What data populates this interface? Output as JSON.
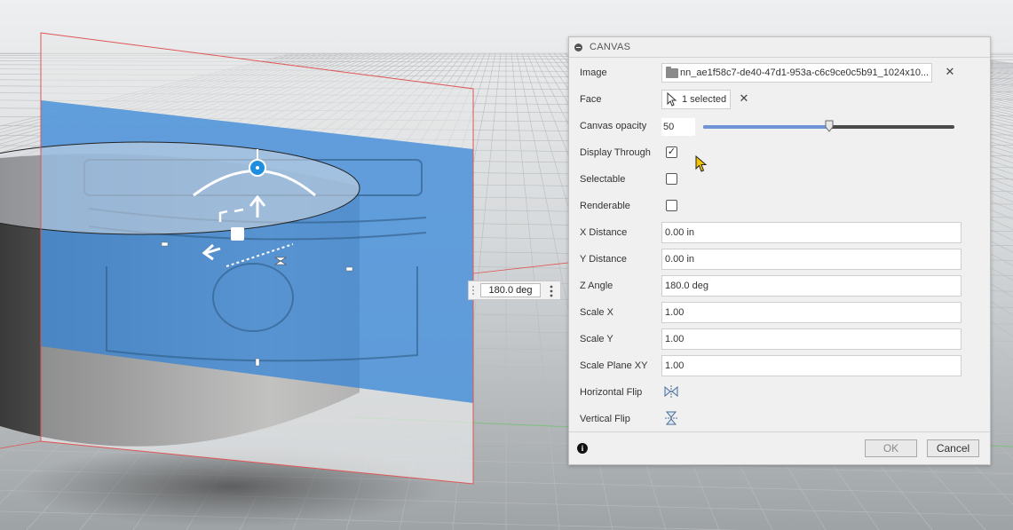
{
  "canvas_dialog": {
    "title": "CANVAS",
    "image": {
      "label": "Image",
      "value": "nn_ae1f58c7-de40-47d1-953a-c6c9ce0c5b91_1024x10..."
    },
    "face": {
      "label": "Face",
      "value": "1 selected"
    },
    "canvas_opacity": {
      "label": "Canvas opacity",
      "value": "50",
      "level_percent": 50
    },
    "display_through": {
      "label": "Display Through",
      "checked": true
    },
    "selectable": {
      "label": "Selectable",
      "checked": false
    },
    "renderable": {
      "label": "Renderable",
      "checked": false
    },
    "x_distance": {
      "label": "X Distance",
      "value": "0.00 in"
    },
    "y_distance": {
      "label": "Y Distance",
      "value": "0.00 in"
    },
    "z_angle": {
      "label": "Z Angle",
      "value": "180.0 deg"
    },
    "scale_x": {
      "label": "Scale X",
      "value": "1.00"
    },
    "scale_y": {
      "label": "Scale Y",
      "value": "1.00"
    },
    "scale_plane_xy": {
      "label": "Scale Plane XY",
      "value": "1.00"
    },
    "horizontal_flip": {
      "label": "Horizontal Flip",
      "icon": "horizontal-flip-icon"
    },
    "vertical_flip": {
      "label": "Vertical Flip",
      "icon": "vertical-flip-icon"
    },
    "ok_label": "OK",
    "cancel_label": "Cancel"
  },
  "angle_input": {
    "value": "180.0 deg"
  },
  "colors": {
    "canvas_plane_blue": "#4a90d9",
    "slider_fill": "#6f95d6",
    "manipulator_blue": "#1e8fe0",
    "plane_border": "#e05555"
  }
}
